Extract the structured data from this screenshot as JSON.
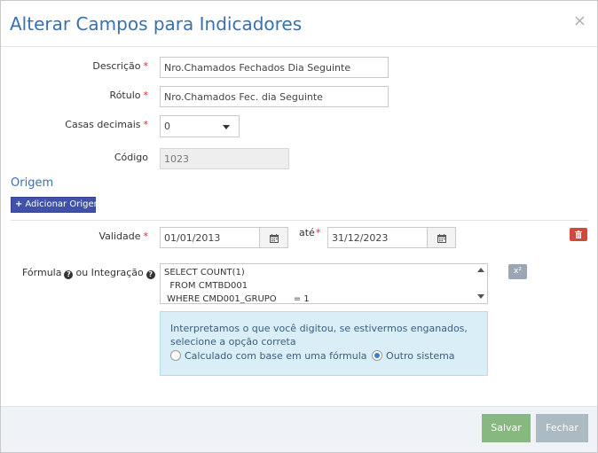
{
  "modal": {
    "title": "Alterar Campos para Indicadores",
    "close_label": "×"
  },
  "fields": {
    "descricao": {
      "label": "Descrição",
      "required": "*",
      "value": "Nro.Chamados Fechados Dia Seguinte"
    },
    "rotulo": {
      "label": "Rótulo",
      "required": "*",
      "value": "Nro.Chamados Fec. dia Seguinte"
    },
    "casas_decimais": {
      "label": "Casas decimais",
      "required": "*",
      "value": "0"
    },
    "codigo": {
      "label": "Código",
      "value": "1023"
    }
  },
  "origem": {
    "title": "Origem",
    "add_button": "Adicionar Origem"
  },
  "validade": {
    "label": "Validade",
    "required": "*",
    "start": "01/01/2013",
    "ate_label": "até",
    "ate_required": "*",
    "end": "31/12/2023"
  },
  "formula": {
    "label_formula": "Fórmula",
    "label_ou": "ou Integração",
    "lines": [
      "SELECT COUNT(1)",
      "  FROM CMTBD001",
      " WHERE CMD001_GRUPO      = 1"
    ],
    "sup_button": "x²"
  },
  "info": {
    "message": "Interpretamos o que você digitou, se estivermos enganados, selecione a opção correta",
    "option_formula": "Calculado com base em uma fórmula",
    "option_outro": "Outro sistema",
    "selected": "Outro sistema"
  },
  "footer": {
    "save": "Salvar",
    "close": "Fechar"
  },
  "colors": {
    "title": "#3a6fb0",
    "add_button": "#3f51a8",
    "trash_button": "#d0493a",
    "save_button": "#87b87f",
    "close_button": "#abbac3",
    "info_bg": "#d9eef7"
  }
}
